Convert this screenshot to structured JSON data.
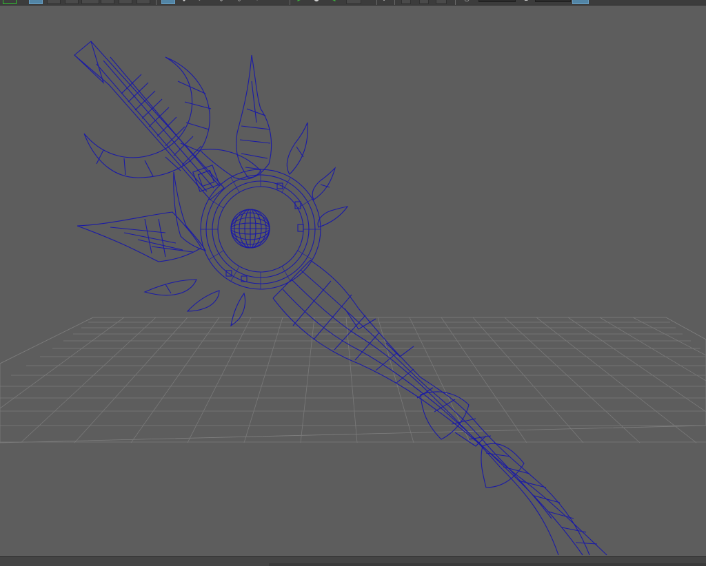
{
  "app": {
    "name": "3D modeling viewport"
  },
  "colors": {
    "viewport_bg": "#5d5d5d",
    "grid": "#7a7a7a",
    "wire": "#1a1aa6",
    "toolbar_bg": "#3c3c3c",
    "active_button": "#5285a6",
    "select_highlight": "#31c131"
  },
  "viewport": {
    "display_mode": "wireframe",
    "grid_visible": true,
    "object": "staff model"
  },
  "toolbar": {
    "icons": [
      "select-mode-icon",
      "wireframe-icon",
      "shaded-icon",
      "textured-icon",
      "lighting-icon",
      "shadow-icon",
      "camera-icon",
      "isolate-icon",
      "xray-icon",
      "grid-icon",
      "resolution-icon",
      "gate-icon",
      "exposure-field",
      "gamma-field",
      "colorspace-icon"
    ]
  }
}
